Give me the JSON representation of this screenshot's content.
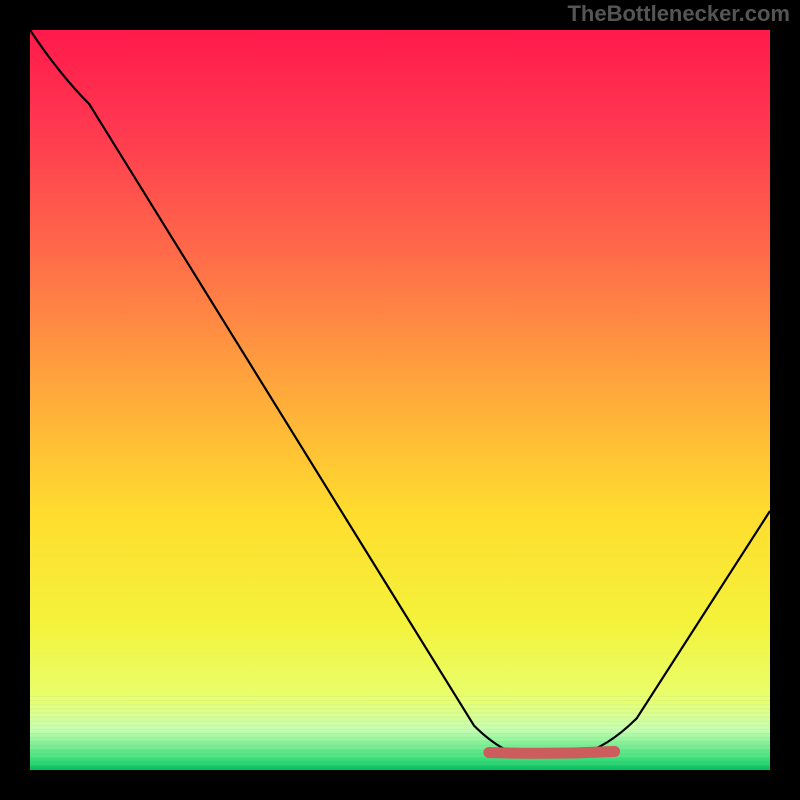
{
  "watermark": "TheBottlenecker.com",
  "chart_data": {
    "type": "line",
    "title": "",
    "xlabel": "",
    "ylabel": "",
    "xlim": [
      0,
      100
    ],
    "ylim": [
      0,
      100
    ],
    "categories_note": "x in percent of plot width, y in percent of plot height (0 bottom, 100 top)",
    "series": [
      {
        "name": "curve",
        "color": "#000000",
        "points": [
          {
            "x": 0,
            "y": 100
          },
          {
            "x": 4,
            "y": 94
          },
          {
            "x": 8,
            "y": 90
          },
          {
            "x": 60,
            "y": 6
          },
          {
            "x": 63,
            "y": 3
          },
          {
            "x": 66,
            "y": 2
          },
          {
            "x": 74,
            "y": 2
          },
          {
            "x": 78,
            "y": 3
          },
          {
            "x": 82,
            "y": 7
          },
          {
            "x": 100,
            "y": 35
          }
        ]
      },
      {
        "name": "flat-highlight",
        "color": "#cd5c5c",
        "x_start": 62,
        "x_end": 79,
        "y": 2.5
      }
    ],
    "gradient_stops": [
      {
        "offset": 0.0,
        "color": "#ff1a4b"
      },
      {
        "offset": 0.12,
        "color": "#ff3550"
      },
      {
        "offset": 0.3,
        "color": "#ff6a4a"
      },
      {
        "offset": 0.48,
        "color": "#ffa63c"
      },
      {
        "offset": 0.65,
        "color": "#ffdc2e"
      },
      {
        "offset": 0.8,
        "color": "#f4f23a"
      },
      {
        "offset": 0.905,
        "color": "#e8ff6e"
      },
      {
        "offset": 0.945,
        "color": "#c7ffb0"
      },
      {
        "offset": 0.985,
        "color": "#3bdf7a"
      },
      {
        "offset": 1.0,
        "color": "#00c05b"
      }
    ],
    "bands_note": "near-bottom region has visible horizontal banding"
  }
}
